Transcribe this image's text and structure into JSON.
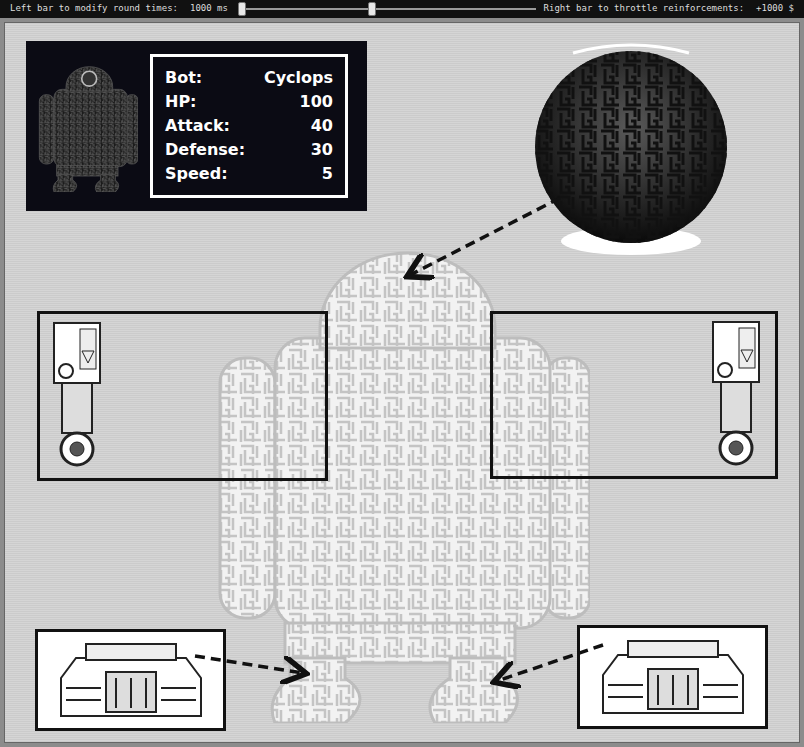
{
  "top_bar": {
    "round_label": "Left bar to modify round times:",
    "round_value": "1000 ms",
    "round_level": 0.0,
    "reinforce_label": "Right bar to throttle reinforcements:",
    "reinforce_value": "+1000 $",
    "reinforce_level": 0.0
  },
  "bot_card": {
    "stats": [
      {
        "label": "Bot:",
        "value": "Cyclops"
      },
      {
        "label": "HP:",
        "value": "100"
      },
      {
        "label": "Attack:",
        "value": "40"
      },
      {
        "label": "Defense:",
        "value": "30"
      },
      {
        "label": "Speed:",
        "value": "5"
      }
    ]
  }
}
